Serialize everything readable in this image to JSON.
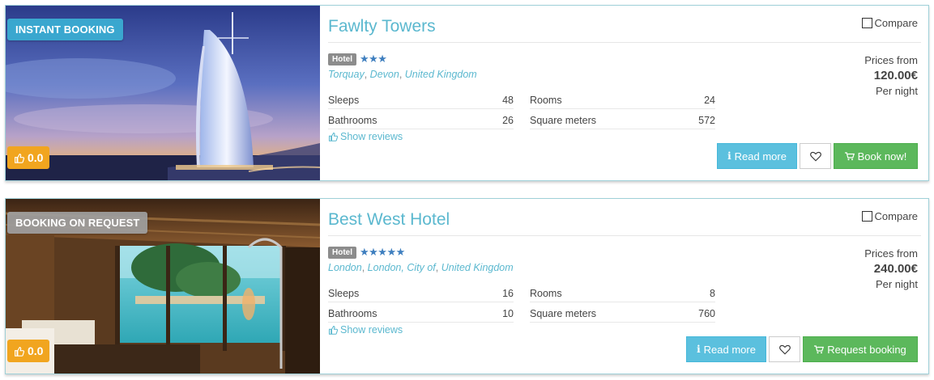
{
  "listings": [
    {
      "booking_badge": "INSTANT BOOKING",
      "rating": "0.0",
      "title": "Fawlty Towers",
      "type": "Hotel",
      "star_count": 3,
      "stars": "★★★",
      "location": {
        "a": "Torquay",
        "b": "Devon",
        "c": "United Kingdom",
        "sep": ", "
      },
      "compare_label": "Compare",
      "specs": {
        "sleeps_label": "Sleeps",
        "sleeps_value": "48",
        "bathrooms_label": "Bathrooms",
        "bathrooms_value": "26",
        "rooms_label": "Rooms",
        "rooms_value": "24",
        "sqm_label": "Square meters",
        "sqm_value": "572"
      },
      "show_reviews": "Show reviews",
      "prices_from_label": "Prices from",
      "price": "120.00€",
      "per_night": "Per night",
      "read_more": "Read more",
      "primary_action": "Book now!"
    },
    {
      "booking_badge": "BOOKING ON REQUEST",
      "rating": "0.0",
      "title": "Best West Hotel",
      "type": "Hotel",
      "star_count": 5,
      "stars": "★★★★★",
      "location": {
        "a": "London",
        "b": "London, City of",
        "c": "United Kingdom",
        "sep": ", "
      },
      "compare_label": "Compare",
      "specs": {
        "sleeps_label": "Sleeps",
        "sleeps_value": "16",
        "bathrooms_label": "Bathrooms",
        "bathrooms_value": "10",
        "rooms_label": "Rooms",
        "rooms_value": "8",
        "sqm_label": "Square meters",
        "sqm_value": "760"
      },
      "show_reviews": "Show reviews",
      "prices_from_label": "Prices from",
      "price": "240.00€",
      "per_night": "Per night",
      "read_more": "Read more",
      "primary_action": "Request booking"
    }
  ],
  "colors": {
    "accent": "#5bb8cf",
    "instant_badge": "#3aa7cf",
    "request_badge": "#9e9e9e",
    "rating_badge": "#f1a51f",
    "read_more_button": "#5bc0de",
    "primary_button": "#5cb85c",
    "stars": "#3f7fbf"
  },
  "icons": {
    "rating": "thumbs-up-icon",
    "reviews": "thumbs-up-icon",
    "read_more": "info-icon",
    "wishlist": "heart-icon",
    "primary_action": "cart-icon",
    "compare": "checkbox"
  }
}
